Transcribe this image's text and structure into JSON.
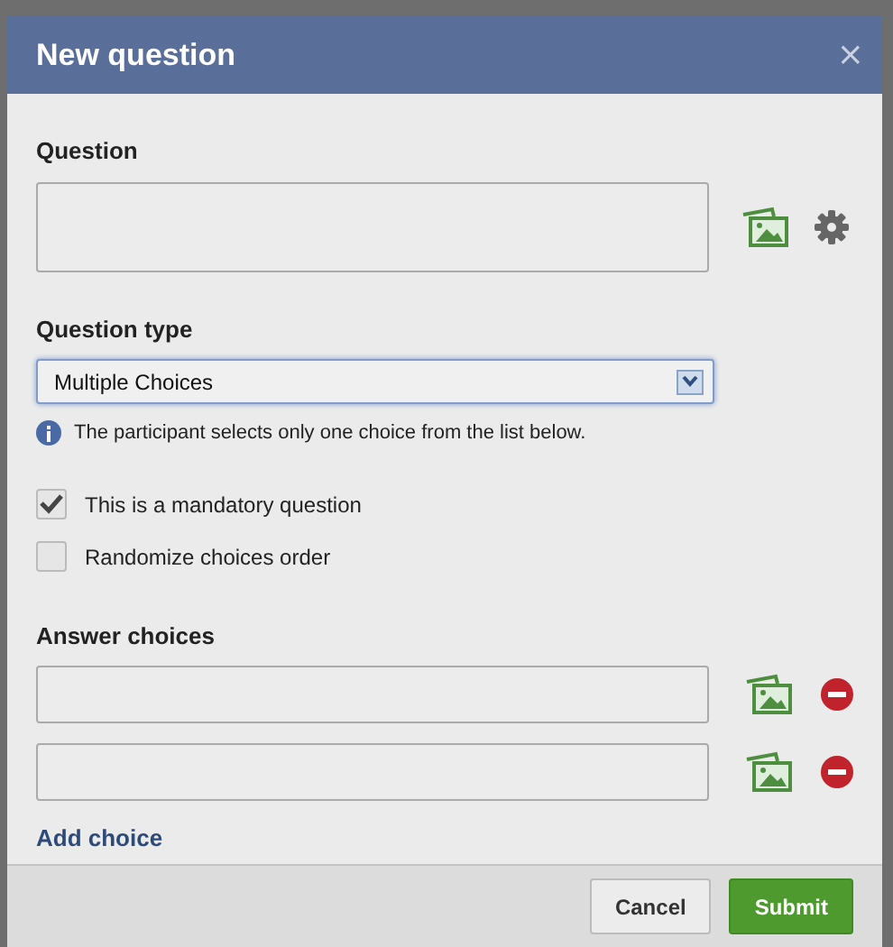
{
  "window": {
    "title": "New question",
    "close": "×"
  },
  "question": {
    "label": "Question"
  },
  "question_type": {
    "label": "Question type",
    "value": "Multiple Choices",
    "hint": "The participant selects only one choice from the list below."
  },
  "options": [
    {
      "label": "This is a mandatory question",
      "checked": true
    },
    {
      "label": "Randomize choices order",
      "checked": false
    }
  ],
  "answer_choices": {
    "label": "Answer choices",
    "fields": [
      {
        "kind": "text"
      },
      {
        "kind": "text"
      }
    ],
    "add_link": "Add choice"
  },
  "buttons": [
    {
      "label": "Cancel",
      "kind": "secondary"
    },
    {
      "label": "Submit",
      "kind": "primary"
    }
  ]
}
